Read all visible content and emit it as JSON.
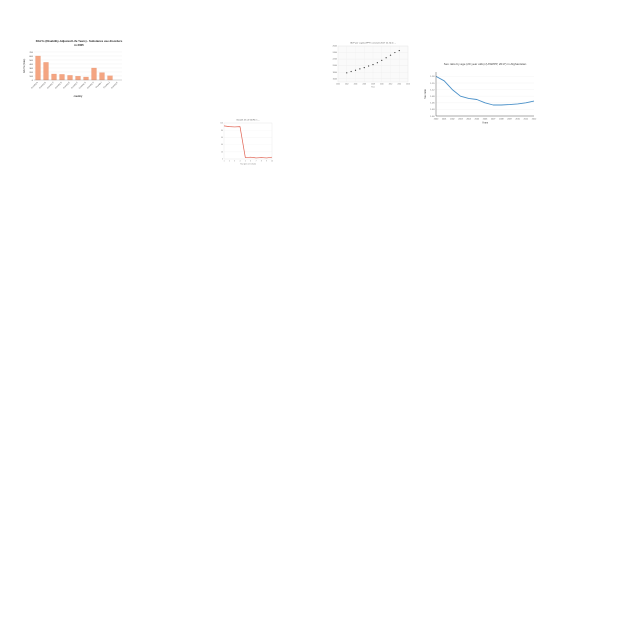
{
  "chart_data": [
    {
      "type": "bar",
      "title": "DALYs (Disability-Adjusted Life Years) - Substance use disorders",
      "subtitle": "in 2005",
      "xlabel": "country",
      "ylabel": "DALYs (Rate)",
      "ylim": [
        0,
        700
      ],
      "ytick_labels": [
        "0",
        "100",
        "200",
        "300",
        "400",
        "500",
        "600",
        "700"
      ],
      "grid": true,
      "bar_color": "#f4a582",
      "categories": [
        "Country A",
        "Country B",
        "Country C",
        "Country D",
        "Country E",
        "Country F",
        "Country G",
        "Country H",
        "Country I",
        "Country J",
        "Country K"
      ],
      "values": [
        600,
        440,
        150,
        140,
        115,
        95,
        75,
        300,
        185,
        105,
        0
      ]
    },
    {
      "type": "scatter",
      "title": "GDP per capita (PPP, constant 2017 int. $) in ...",
      "xlabel": "Year",
      "ylabel": "",
      "marker_color": "#333333",
      "grid": true,
      "x": [
        2002,
        2003,
        2004,
        2005,
        2006,
        2007,
        2008,
        2009,
        2010,
        2011,
        2012,
        2013,
        2014
      ],
      "y": [
        17800,
        18200,
        18600,
        19000,
        19400,
        19900,
        20300,
        20900,
        21600,
        22400,
        23200,
        24000,
        24600
      ],
      "xlim": [
        2000,
        2016
      ],
      "ylim": [
        15000,
        26000
      ]
    },
    {
      "type": "line",
      "title": "Sex ratio by age (20 year olds) (UNWPP, 2017) in Afghanistan",
      "xlabel": "Years",
      "ylabel": "Sex ratio",
      "line_color": "#4a90c8",
      "grid": true,
      "x": [
        2000,
        2001,
        2002,
        2003,
        2004,
        2005,
        2006,
        2007,
        2008,
        2009,
        2010,
        2011,
        2012
      ],
      "y": [
        1.18,
        1.16,
        1.12,
        1.09,
        1.08,
        1.075,
        1.06,
        1.05,
        1.05,
        1.052,
        1.055,
        1.06,
        1.068
      ],
      "xtick_labels": [
        "2000",
        "2001",
        "2002",
        "2003",
        "2004",
        "2005",
        "2006",
        "2007",
        "2008",
        "2009",
        "2010",
        "2011",
        "2012"
      ],
      "ylim": [
        1.0,
        1.2
      ],
      "ytick_labels": [
        "1.00",
        "1.03",
        "1.06",
        "1.09",
        "1.12",
        "1.15",
        "1.18"
      ]
    },
    {
      "type": "line",
      "title": "Growth (% of GDP) in ...",
      "xlabel": "Year (per cent share)",
      "ylabel": "",
      "line_color": "#e06050",
      "grid": true,
      "x": [
        1,
        2,
        3,
        4,
        5,
        6,
        7,
        8,
        9,
        10
      ],
      "y": [
        92,
        90,
        89,
        90,
        4,
        5,
        3,
        4,
        3,
        5
      ],
      "ylim": [
        0,
        100
      ]
    }
  ]
}
